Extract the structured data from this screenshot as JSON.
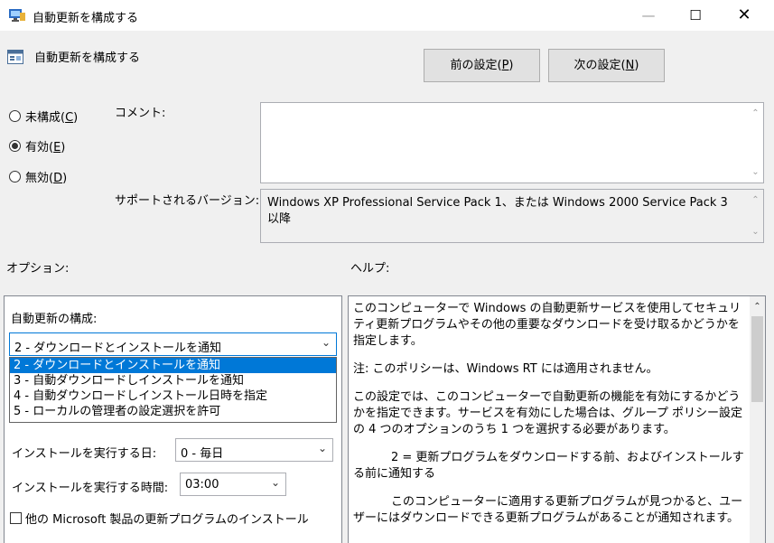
{
  "window": {
    "title": "自動更新を構成する",
    "controls": {
      "minimize": "—",
      "maximize": "☐",
      "close": "✕"
    }
  },
  "header": {
    "policy_title": "自動更新を構成する",
    "prev_label": "前の設定(",
    "prev_key": "P",
    "prev_close": ")",
    "next_label": "次の設定(",
    "next_key": "N",
    "next_close": ")"
  },
  "state": {
    "not_configured": {
      "text": "未構成(",
      "key": "C",
      "close": ")"
    },
    "enabled": {
      "text": "有効(",
      "key": "E",
      "close": ")",
      "selected": true
    },
    "disabled": {
      "text": "無効(",
      "key": "D",
      "close": ")"
    }
  },
  "comment": {
    "label": "コメント:",
    "value": ""
  },
  "supported": {
    "label": "サポートされるバージョン:",
    "value": "Windows XP Professional Service Pack 1、または Windows 2000 Service Pack 3 以降"
  },
  "sections": {
    "options_label": "オプション:",
    "help_label": "ヘルプ:"
  },
  "options": {
    "configure_label": "自動更新の構成:",
    "configure_value": "2 - ダウンロードとインストールを通知",
    "configure_list": [
      "2 - ダウンロードとインストールを通知",
      "3 - 自動ダウンロードしインストールを通知",
      "4 - 自動ダウンロードしインストール日時を指定",
      "5 - ローカルの管理者の設定選択を許可"
    ],
    "day_label": "インストールを実行する日:",
    "day_value": "0 - 毎日",
    "time_label": "インストールを実行する時間:",
    "time_value": "03:00",
    "other_products_label": "他の Microsoft 製品の更新プログラムのインストール"
  },
  "help": {
    "p1": "このコンピューターで Windows の自動更新サービスを使用してセキュリティ更新プログラムやその他の重要なダウンロードを受け取るかどうかを指定します。",
    "p2": "注: このポリシーは、Windows RT には適用されません。",
    "p3": "この設定では、このコンピューターで自動更新の機能を有効にするかどうかを指定できます。サービスを有効にした場合は、グループ ポリシー設定の 4 つのオプションのうち 1 つを選択する必要があります。",
    "p4": "2 = 更新プログラムをダウンロードする前、およびインストールする前に通知する",
    "p5": "このコンピューターに適用する更新プログラムが見つかると、ユーザーにはダウンロードできる更新プログラムがあることが通知されます。"
  }
}
